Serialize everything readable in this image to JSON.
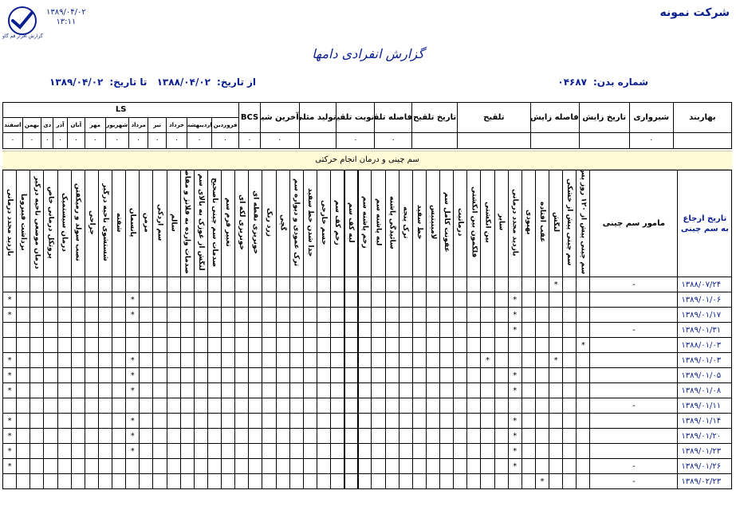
{
  "header": {
    "company": "شرکت نمونه",
    "print_date": "۱۳۸۹/۰۴/۰۲",
    "print_time": "۱۳:۱۱",
    "logo_caption": "گزارش افزار قم گاو"
  },
  "report": {
    "title": "گزارش انفرادی دامها",
    "cow_label": "شماره بدن:",
    "cow_number": "۰۴۶۸۷",
    "from_label": "از تاریخ:",
    "from_date": "۱۳۸۸/۰۴/۰۲",
    "to_label": "تا تاریخ:",
    "to_date": "۱۳۸۹/۰۴/۰۲"
  },
  "summary": {
    "headers": [
      "بهاربند",
      "شیرواری",
      "تاریخ زایش",
      "فاصله زایش",
      "تلقیح",
      "تاریخ تلقیح",
      "فاصله تلقیح",
      "نوبت تلقیح",
      "تولید مثلی",
      "آخرین شیر",
      "BCS"
    ],
    "ls_label": "LS",
    "months": [
      "فروردین",
      "اردیبهشت",
      "خرداد",
      "تیر",
      "مرداد",
      "شهریور",
      "مهر",
      "آبان",
      "آذر",
      "دی",
      "بهمن",
      "اسفند"
    ],
    "values": [
      "",
      "۰",
      "",
      "",
      "",
      "",
      "۰",
      "۰",
      "",
      "۰",
      "۰"
    ],
    "month_values": [
      "۰",
      "۰",
      "۰",
      "۰",
      "۰",
      "۰",
      "۰",
      "۰",
      "۰",
      "۰",
      "۰",
      "۰"
    ]
  },
  "banner": "سم چینی و درمان انجام حرکتی",
  "table": {
    "date_header": "تاریخ ارجاع به سم چینی",
    "agent_header": "مامور سم چینی",
    "columns": [
      "سم چینی پیش از ۱۲۰ روز پس از زایش",
      "سم چینی پیش از خشکی",
      "لنگش",
      "عقب افتاده",
      "بهبودی",
      "بازدید مجدد درمانی",
      "سایر",
      "بین انگشتی",
      "فلگمون بین انگشتی",
      "درماتیت",
      "عفونت کامل سم",
      "لامینیتیس",
      "خط سفید",
      "ترک پنجه",
      "سائیدگی پاشنه",
      "لبه پاشنه سم",
      "زخم پاشنه سم",
      "لبه کف سم",
      "زخم کف سم",
      "جسم خارجی",
      "جدا شدن خط سفید",
      "ترک عمودی و دیواره سم",
      "گچی",
      "زرد رنگ",
      "خونریزی نقطه ای",
      "خونریزی لکه ای",
      "تغییر فرم سم",
      "صدمات سم چینی ناصحیح",
      "لنگش از غوزک به بالای سم",
      "صدمات وارده به فلانژ و مفاصل",
      "سالم",
      "سم اردکی",
      "مزمن",
      "پانسمان",
      "شفته",
      "شستشوی ناحیه درگیر",
      "جراحی",
      "نصب سولد و رمیکفتن",
      "درمان سیستمیک",
      "پروتکل درمانی خاص",
      "درمان موضعی ناحیه درگیر",
      "برداشت فیبروما",
      "بازدید مجدد درمانی"
    ],
    "rows": [
      {
        "date": "۱۳۸۸/۰۷/۲۴",
        "agent": "-",
        "marks": [
          2
        ]
      },
      {
        "date": "۱۳۸۹/۰۱/۰۶",
        "agent": "",
        "marks": [
          5,
          33,
          42
        ]
      },
      {
        "date": "۱۳۸۹/۰۱/۱۷",
        "agent": "",
        "marks": [
          5,
          33,
          42
        ]
      },
      {
        "date": "۱۳۸۹/۰۱/۳۱",
        "agent": "-",
        "marks": [
          5
        ]
      },
      {
        "date": "۱۳۸۸/۰۱/۰۳",
        "agent": "",
        "marks": [
          0
        ]
      },
      {
        "date": "۱۳۸۹/۰۱/۰۳",
        "agent": "",
        "marks": [
          2,
          7,
          33,
          42
        ]
      },
      {
        "date": "۱۳۸۹/۰۱/۰۵",
        "agent": "",
        "marks": [
          5,
          33,
          42
        ]
      },
      {
        "date": "۱۳۸۹/۰۱/۰۸",
        "agent": "",
        "marks": [
          5,
          33,
          42
        ]
      },
      {
        "date": "۱۳۸۹/۰۱/۱۱",
        "agent": "-",
        "marks": []
      },
      {
        "date": "۱۳۸۹/۰۱/۱۴",
        "agent": "",
        "marks": [
          5,
          33,
          42
        ]
      },
      {
        "date": "۱۳۸۹/۰۱/۲۰",
        "agent": "",
        "marks": [
          5,
          33,
          42
        ]
      },
      {
        "date": "۱۳۸۹/۰۱/۲۳",
        "agent": "",
        "marks": [
          5,
          33,
          42
        ]
      },
      {
        "date": "۱۳۸۹/۰۱/۲۶",
        "agent": "-",
        "marks": [
          5,
          42
        ]
      },
      {
        "date": "۱۳۸۹/۰۲/۲۳",
        "agent": "-",
        "marks": [
          3
        ]
      }
    ],
    "mark": "*"
  }
}
